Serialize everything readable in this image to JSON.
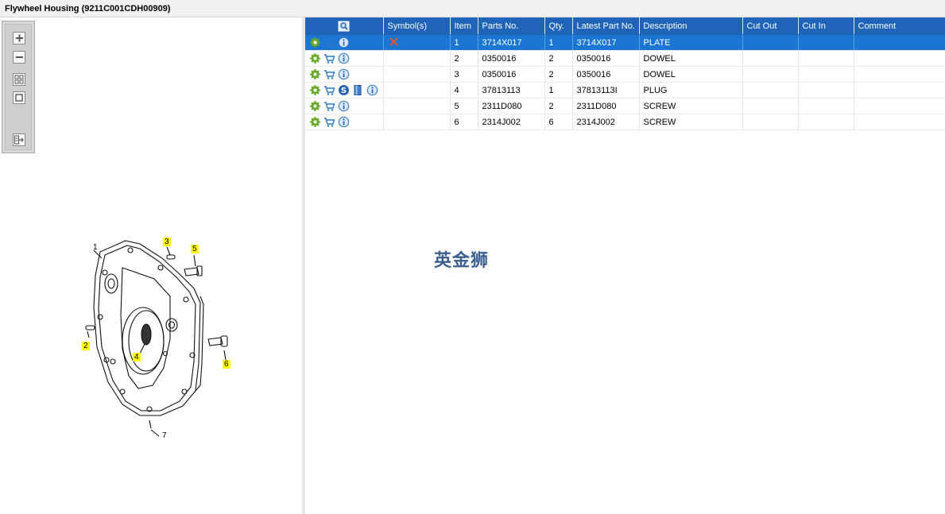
{
  "window": {
    "title": "Flywheel Housing (9211C001CDH00909)"
  },
  "toolbar": {
    "buttons": [
      {
        "name": "zoom-in-button",
        "icon": "plus-icon"
      },
      {
        "name": "zoom-out-button",
        "icon": "minus-icon"
      },
      {
        "name": "fit-all-button",
        "icon": "grid-icon"
      },
      {
        "name": "actual-size-button",
        "icon": "square-icon"
      },
      {
        "name": "export-button",
        "icon": "export-icon"
      }
    ]
  },
  "drawing": {
    "callouts": [
      {
        "label": "1",
        "highlighted": false
      },
      {
        "label": "2",
        "highlighted": true
      },
      {
        "label": "3",
        "highlighted": true
      },
      {
        "label": "4",
        "highlighted": true
      },
      {
        "label": "5",
        "highlighted": true
      },
      {
        "label": "6",
        "highlighted": true
      },
      {
        "label": "7",
        "highlighted": false
      }
    ]
  },
  "table": {
    "columns": [
      "",
      "Symbol(s)",
      "Item",
      "Parts No.",
      "Qty.",
      "Latest Part No.",
      "Description",
      "Cut Out",
      "Cut In",
      "Comment"
    ],
    "rows": [
      {
        "icons": [
          "gear-icon",
          "cart-icon",
          "info-icon"
        ],
        "symbol": "cross-icon",
        "item": "1",
        "part_no": "3714X017",
        "qty": "1",
        "latest_part_no": "3714X017",
        "description": "PLATE",
        "cut_out": "",
        "cut_in": "",
        "comment": "",
        "selected": true
      },
      {
        "icons": [
          "gear-icon",
          "cart-icon",
          "info-icon"
        ],
        "symbol": "",
        "item": "2",
        "part_no": "0350016",
        "qty": "2",
        "latest_part_no": "0350016",
        "description": "DOWEL",
        "cut_out": "",
        "cut_in": "",
        "comment": "",
        "selected": false
      },
      {
        "icons": [
          "gear-icon",
          "cart-icon",
          "info-icon"
        ],
        "symbol": "",
        "item": "3",
        "part_no": "0350016",
        "qty": "2",
        "latest_part_no": "0350016",
        "description": "DOWEL",
        "cut_out": "",
        "cut_in": "",
        "comment": "",
        "selected": false
      },
      {
        "icons": [
          "gear-icon",
          "cart-icon",
          "supersede-icon",
          "book-icon",
          "info-icon"
        ],
        "symbol": "",
        "item": "4",
        "part_no": "37813113",
        "qty": "1",
        "latest_part_no": "37813113I",
        "description": "PLUG",
        "cut_out": "",
        "cut_in": "",
        "comment": "",
        "selected": false
      },
      {
        "icons": [
          "gear-icon",
          "cart-icon",
          "info-icon"
        ],
        "symbol": "",
        "item": "5",
        "part_no": "2311D080",
        "qty": "2",
        "latest_part_no": "2311D080",
        "description": "SCREW",
        "cut_out": "",
        "cut_in": "",
        "comment": "",
        "selected": false
      },
      {
        "icons": [
          "gear-icon",
          "cart-icon",
          "info-icon"
        ],
        "symbol": "",
        "item": "6",
        "part_no": "2314J002",
        "qty": "6",
        "latest_part_no": "2314J002",
        "description": "SCREW",
        "cut_out": "",
        "cut_in": "",
        "comment": "",
        "selected": false
      }
    ]
  },
  "watermark": {
    "text": "英金狮",
    "color": "#3a5f8f"
  },
  "colors": {
    "header_bg": "#1f64b8",
    "selected_row_bg": "#1a76d2",
    "callout_highlight": "#ffff00"
  }
}
